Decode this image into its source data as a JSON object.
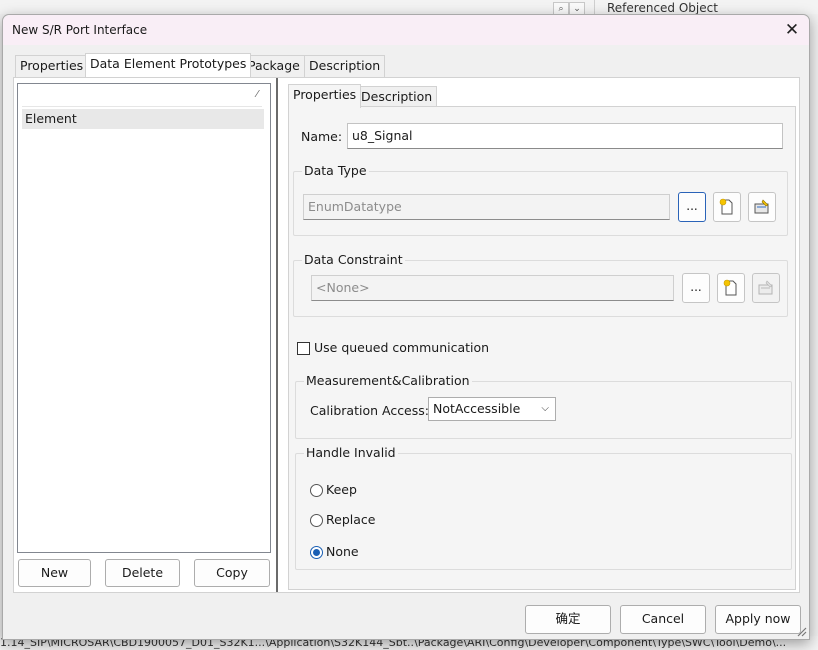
{
  "background": {
    "right_window_text": "Referenced Object",
    "bottom_status": "1.14_SIP\\MICROSAR\\CBD1900057_D01_S32K1...\\Application\\S32K144_Sbt..\\Package\\ARI\\Config\\Developer\\Component\\Type\\SWC\\Tool\\Demo\\...",
    "scroll_icons": [
      "search-icon",
      "chevron-down-icon"
    ]
  },
  "dialog": {
    "title": "New S/R Port Interface",
    "close_glyph": "✕"
  },
  "tabs": [
    {
      "label": "Properties"
    },
    {
      "label": "Data Element Prototypes"
    },
    {
      "label": "Package"
    },
    {
      "label": "Description"
    }
  ],
  "list": {
    "filter_glyph": "⁄",
    "items": [
      {
        "label": "Element"
      }
    ]
  },
  "list_buttons": {
    "new": "New",
    "delete": "Delete",
    "copy": "Copy"
  },
  "detail_tabs": [
    {
      "label": "Properties"
    },
    {
      "label": "Description"
    }
  ],
  "form": {
    "name_label": "Name:",
    "name_value": "u8_Signal",
    "data_type": {
      "group_label": "Data Type",
      "value": "EnumDatatype",
      "browse_label": "..."
    },
    "data_constraint": {
      "group_label": "Data Constraint",
      "value": "<None>",
      "browse_label": "..."
    },
    "queued_label": "Use queued communication",
    "queued_checked": false,
    "measurement": {
      "group_label": "Measurement&Calibration",
      "access_label": "Calibration Access:",
      "access_value": "NotAccessible"
    },
    "handle_invalid": {
      "group_label": "Handle Invalid",
      "options": [
        {
          "label": "Keep",
          "checked": false
        },
        {
          "label": "Replace",
          "checked": false
        },
        {
          "label": "None",
          "checked": true
        }
      ]
    }
  },
  "footer": {
    "ok": "确定",
    "cancel": "Cancel",
    "apply": "Apply now"
  },
  "colors": {
    "title_bar": "#f9eef6",
    "accent": "#1a5fb4",
    "splitter": "#6b6b6b"
  }
}
